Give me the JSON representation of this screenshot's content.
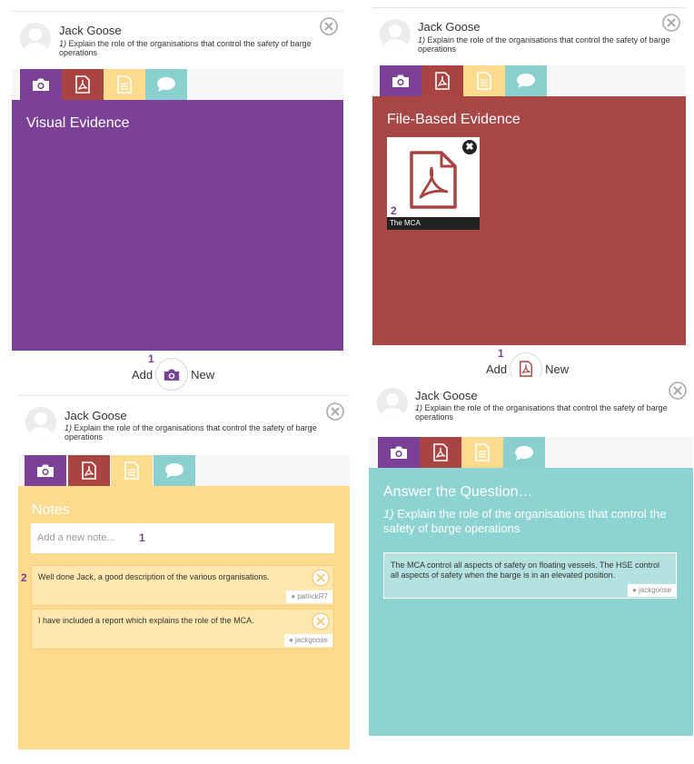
{
  "colors": {
    "photo_tab": "#7b4197",
    "file_tab": "#a94442",
    "notes_tab": "#fddb8e",
    "comment_tab": "#89d0ce",
    "visual_panel": "#7b4197",
    "file_panel": "#a84846",
    "notes_panel": "#fddb8e",
    "answer_panel": "#8cd3d1"
  },
  "common": {
    "student_name": "Jack Goose",
    "question_number": "1)",
    "question_text": "Explain the role of the organisations that control the safety of barge operations"
  },
  "visual": {
    "title": "Visual Evidence",
    "add_label": "Add",
    "new_label": "New",
    "count": "1"
  },
  "file": {
    "title": "File-Based Evidence",
    "file_number": "2",
    "file_name": "The MCA",
    "remove_label": "✖",
    "add_label": "Add",
    "new_label": "New",
    "count": "1"
  },
  "notes": {
    "title": "Notes",
    "input_placeholder": "Add a new note...",
    "input_count": "1",
    "list_count": "2",
    "items": [
      {
        "text": "Well done Jack, a good description of the various organisations.",
        "author": "patrickR7"
      },
      {
        "text": "I have included a report which explains the role of the MCA.",
        "author": "jackgoose"
      }
    ]
  },
  "answer": {
    "title": "Answer the Question…",
    "question_number": "1)",
    "question_text": "Explain the role of the organisations that control the safety of barge operations",
    "answer_text": "The MCA control all aspects of safety on floating vessels. The HSE control all aspects of safety when the barge is in an elevated position.",
    "author": "jackgoose"
  }
}
